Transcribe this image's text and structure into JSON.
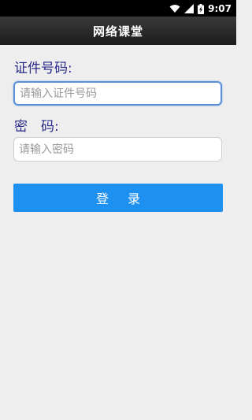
{
  "status_bar": {
    "time": "9:07",
    "icons": [
      "wifi-icon",
      "cellular-signal-icon",
      "battery-charging-icon"
    ]
  },
  "app_bar": {
    "title": "网络课堂"
  },
  "form": {
    "id_label": "证件号码:",
    "id_placeholder": "请输入证件号码",
    "password_label": "密　码:",
    "password_placeholder": "请输入密码",
    "login_button": "登录"
  },
  "colors": {
    "background": "#eeeeee",
    "label": "#2a2a8a",
    "button": "#1e90f0",
    "focus_border": "#5b8fd6"
  }
}
